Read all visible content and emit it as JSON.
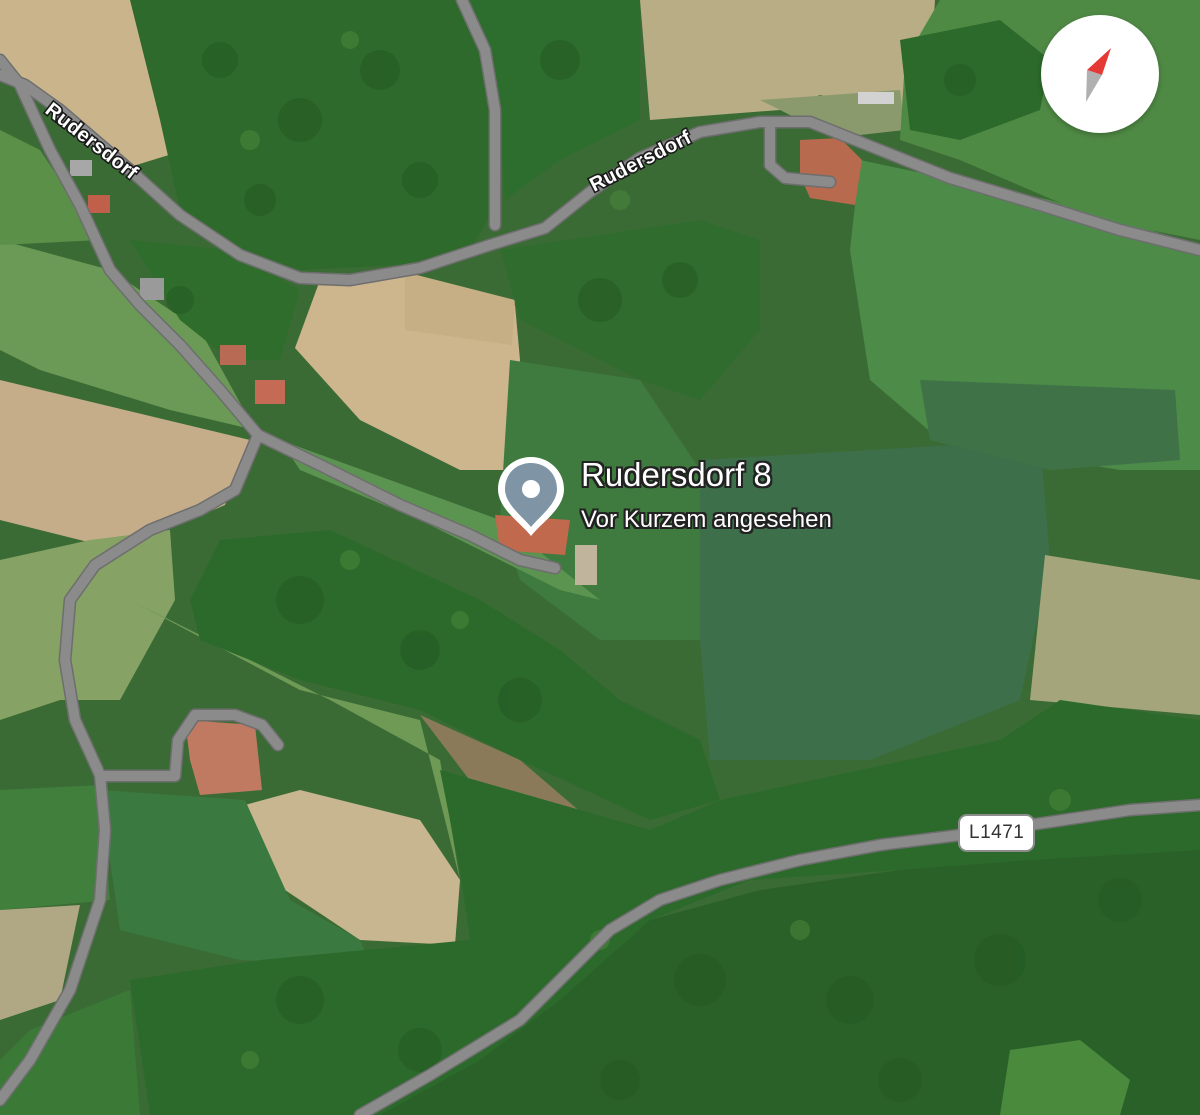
{
  "map": {
    "type": "satellite",
    "road_labels": [
      "Rudersdorf",
      "Rudersdorf"
    ],
    "route_shield": "L1471"
  },
  "place": {
    "title": "Rudersdorf 8",
    "subtitle": "Vor Kurzem angesehen",
    "pin_icon": "place-pin-icon"
  },
  "compass": {
    "icon": "compass-icon",
    "needle_colors": [
      "#e53935",
      "#b0b0b0"
    ]
  },
  "colors": {
    "road": "#8a8a8a",
    "road_outline": "#707070",
    "pin": "#7f95a6"
  }
}
